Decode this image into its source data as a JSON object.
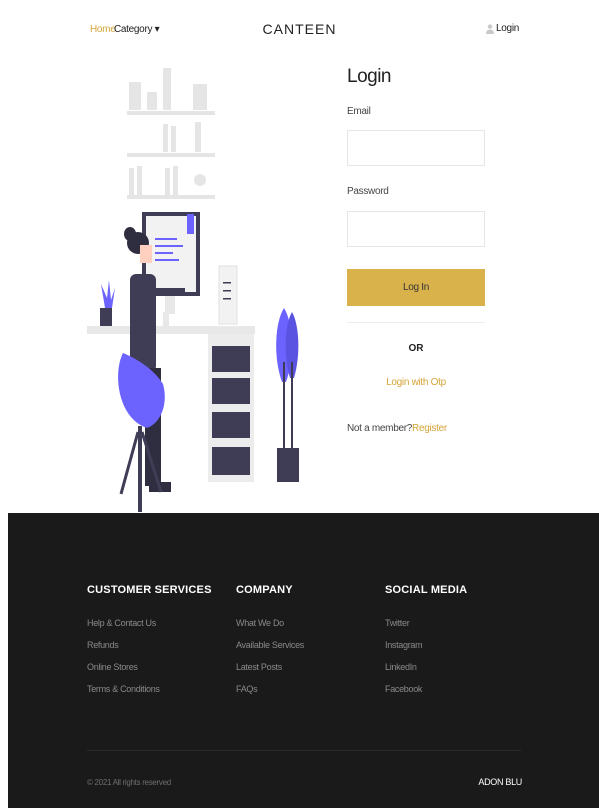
{
  "header": {
    "home": "Home",
    "category": "Category ▾",
    "brand": "CANTEEN",
    "login": "Login"
  },
  "login_form": {
    "title": "Login",
    "email_label": "Email",
    "email_value": "",
    "password_label": "Password",
    "password_value": "",
    "submit_label": "Log In",
    "or_text": "OR",
    "otp_link": "Login with Otp",
    "not_member_text": "Not a member?",
    "register_link": "Register"
  },
  "footer": {
    "columns": [
      {
        "title": "CUSTOMER SERVICES",
        "links": [
          "Help & Contact Us",
          "Refunds",
          "Online Stores",
          "Terms & Conditions"
        ]
      },
      {
        "title": "COMPANY",
        "links": [
          "What We Do",
          "Available Services",
          "Latest Posts",
          "FAQs"
        ]
      },
      {
        "title": "SOCIAL MEDIA",
        "links": [
          "Twitter",
          "Instagram",
          "LinkedIn",
          "Facebook"
        ]
      }
    ],
    "copyright": "© 2021 All rights reserved",
    "brand": "ADON BLU"
  },
  "colors": {
    "accent": "#d9b24c",
    "link_accent": "#d4a437",
    "footer_bg": "#1a1a1a",
    "illustration_purple": "#6c63ff"
  }
}
